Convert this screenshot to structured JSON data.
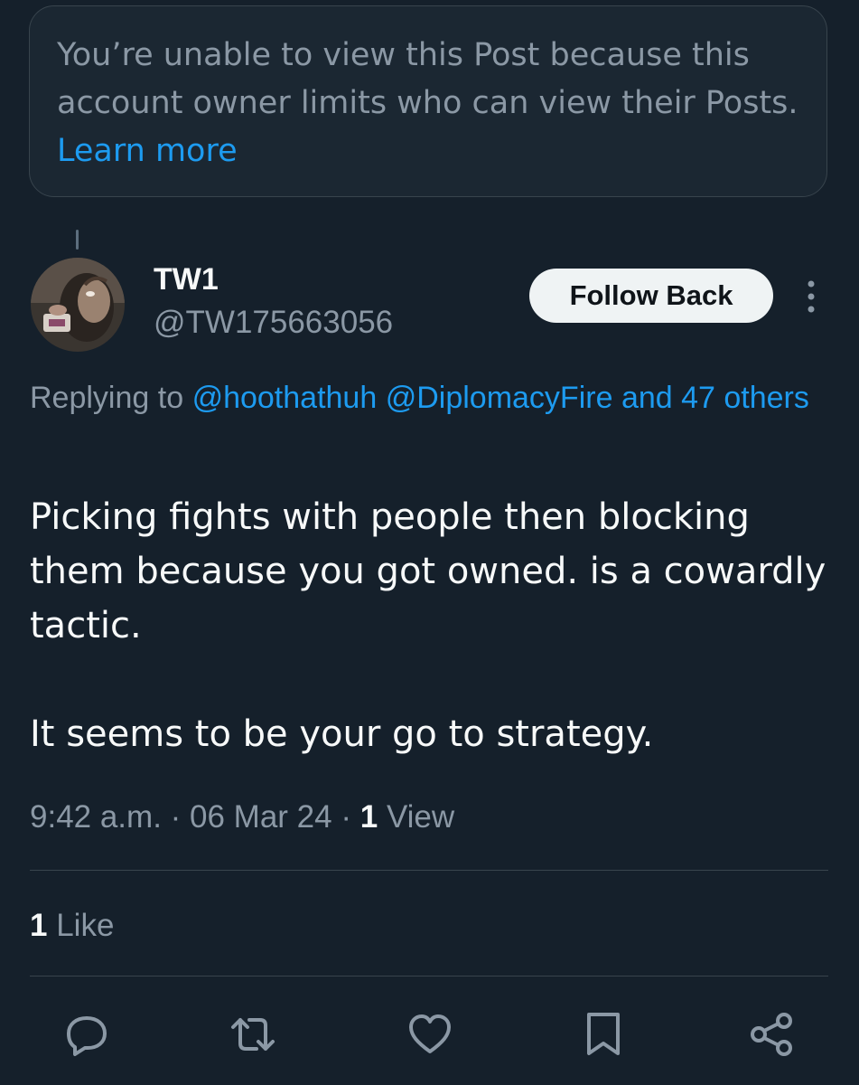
{
  "notice": {
    "text": "You’re unable to view this Post because this account owner limits who can view their Posts.",
    "link": "Learn more"
  },
  "author": {
    "display_name": "TW1",
    "handle": "@TW175663056",
    "avatar_icon": "user-avatar"
  },
  "follow_button": "Follow Back",
  "more_icon": "more-vertical-icon",
  "reply": {
    "prefix": "Replying to",
    "mention1": "@hoothathuh",
    "mention2": "@DiplomacyFire",
    "and_others": "and 47 others"
  },
  "post": {
    "paragraph1": "Picking fights with people then blocking them because you got owned. is a cowardly tactic.",
    "paragraph2": "It seems to be your go to strategy."
  },
  "meta": {
    "time": "9:42 a.m.",
    "sep1": " · ",
    "date": "06 Mar 24",
    "sep2": " · ",
    "views_count": "1",
    "views_label": "View"
  },
  "likes": {
    "count": "1",
    "label": "Like"
  },
  "actions": [
    "reply-icon",
    "repost-icon",
    "like-icon",
    "bookmark-icon",
    "share-icon"
  ],
  "colors": {
    "background": "#15202b",
    "link": "#1d9bf0",
    "secondary_text": "#8b98a5",
    "primary_text": "#f7f9f9"
  }
}
